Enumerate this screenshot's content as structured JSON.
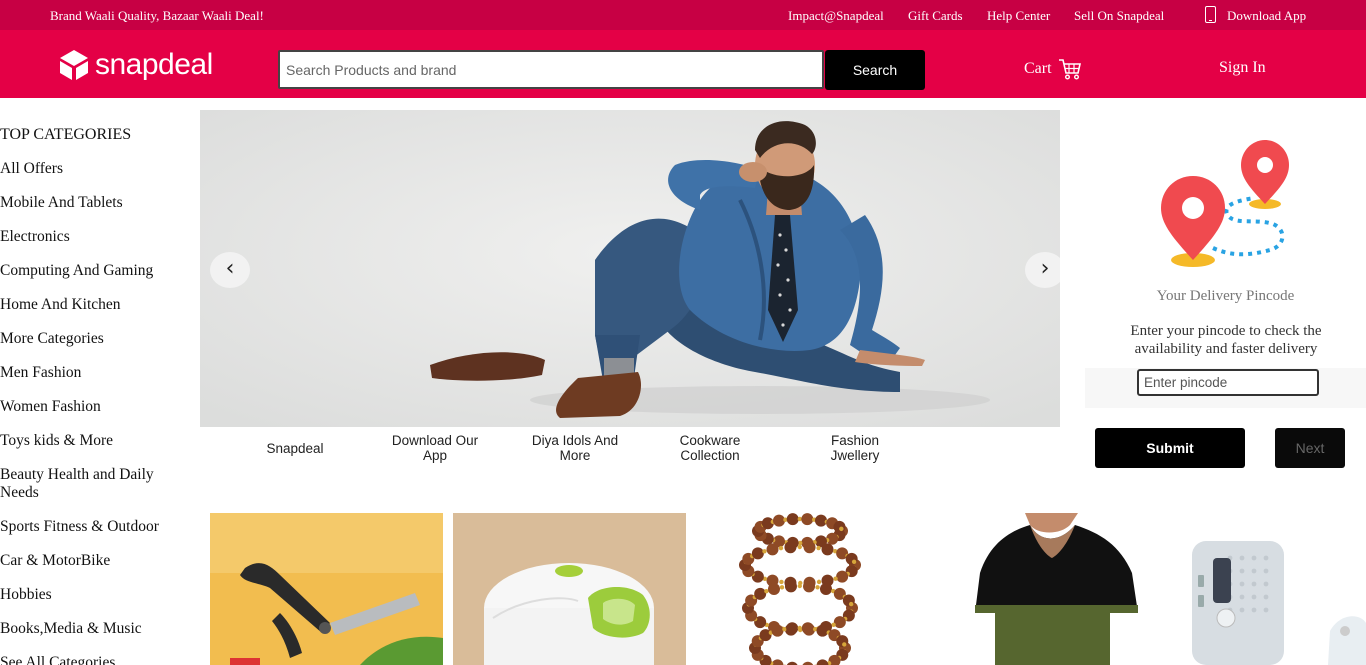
{
  "topbar": {
    "tagline": "Brand Waali Quality, Bazaar Waali Deal!",
    "links": [
      "Impact@Snapdeal",
      "Gift Cards",
      "Help Center",
      "Sell On Snapdeal"
    ],
    "download_app": "Download App"
  },
  "header": {
    "brand": "snapdeal",
    "search_placeholder": "Search Products and brand",
    "search_button": "Search",
    "cart_label": "Cart",
    "signin_label": "Sign In"
  },
  "sidebar": {
    "heading": "TOP CATEGORIES",
    "items": [
      "All Offers",
      "Mobile And Tablets",
      "Electronics",
      "Computing And Gaming",
      "Home And Kitchen",
      "More Categories",
      "Men Fashion",
      "Women Fashion",
      "Toys kids & More",
      "Beauty Health and Daily Needs",
      "Sports Fitness & Outdoor",
      "Car & MotorBike",
      "Hobbies",
      "Books,Media & Music",
      "See All Categories"
    ]
  },
  "carousel": {
    "prev_icon": "chevron-left-icon",
    "next_icon": "chevron-right-icon",
    "labels": [
      "Snapdeal",
      "Download Our App",
      "Diya Idols And More",
      "Cookware Collection",
      "Fashion Jwellery"
    ]
  },
  "pincode": {
    "title": "Your Delivery Pincode",
    "description": "Enter your pincode to check the availability and faster delivery",
    "input_placeholder": "Enter pincode",
    "submit_label": "Submit",
    "next_label": "Next"
  },
  "colors": {
    "brand": "#e40046",
    "topbar": "#c70044",
    "pin_red": "#f04a4f",
    "route_blue": "#29a3e3"
  }
}
